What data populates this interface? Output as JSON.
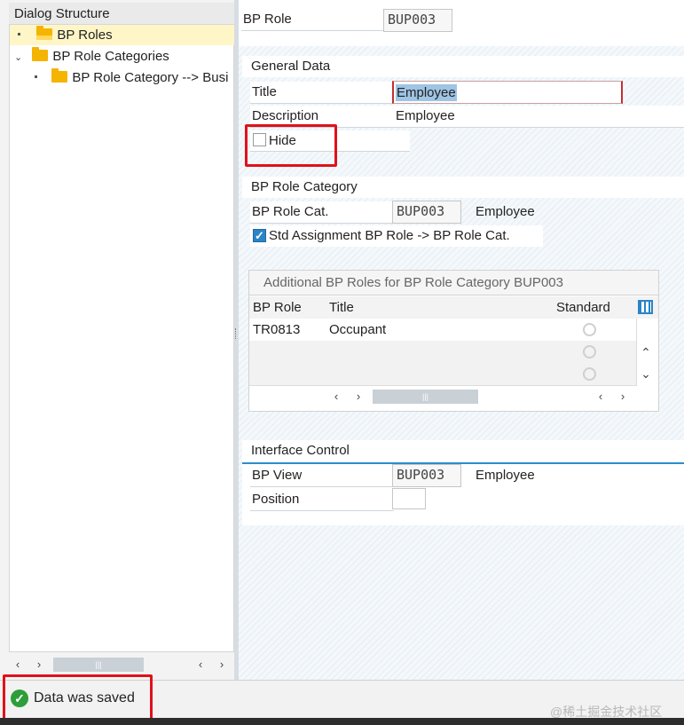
{
  "dialog_structure": {
    "title": "Dialog Structure",
    "items": [
      {
        "label": "BP Roles"
      },
      {
        "label": "BP Role Categories"
      },
      {
        "label": "BP Role Category --> Busi"
      }
    ],
    "scroll_thumb": "|||"
  },
  "bp_role": {
    "label": "BP Role",
    "value": "BUP003"
  },
  "general_data": {
    "header": "General Data",
    "title_label": "Title",
    "title_value": "Employee",
    "description_label": "Description",
    "description_value": "Employee",
    "hide_label": "Hide",
    "hide_checked": false
  },
  "bp_role_category": {
    "header": "BP Role Category",
    "cat_label": "BP Role Cat.",
    "cat_value": "BUP003",
    "cat_text": "Employee",
    "std_assign_label": "Std Assignment BP Role -> BP Role Cat.",
    "std_assign_checked": true
  },
  "additional_roles": {
    "title": "Additional BP Roles for BP Role Category BUP003",
    "columns": [
      "BP Role",
      "Title",
      "Standard"
    ],
    "rows": [
      {
        "role": "TR0813",
        "title": "Occupant"
      },
      {
        "role": "",
        "title": ""
      },
      {
        "role": "",
        "title": ""
      }
    ],
    "scroll_thumb": "|||"
  },
  "interface_control": {
    "header": "Interface Control",
    "view_label": "BP View",
    "view_value": "BUP003",
    "view_text": "Employee",
    "position_label": "Position",
    "position_value": ""
  },
  "status": {
    "message": "Data was saved",
    "type": "success"
  },
  "watermark": "@稀土掘金技术社区",
  "colors": {
    "accent": "#2a8ccc",
    "highlight": "#e0111a",
    "success": "#2e9e3a",
    "folder": "#f5b400"
  }
}
